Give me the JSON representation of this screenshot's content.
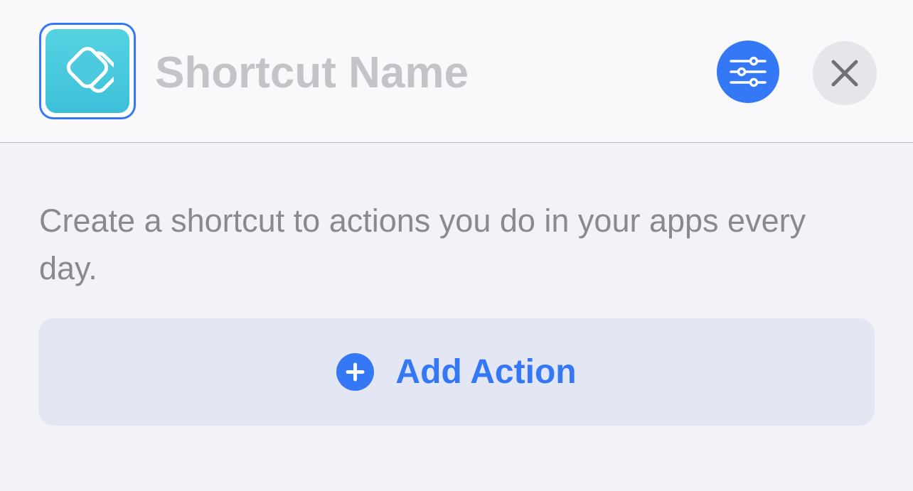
{
  "header": {
    "title_placeholder": "Shortcut Name",
    "app_icon": "shortcuts-layers-icon",
    "settings_icon": "sliders-icon",
    "close_icon": "close-icon"
  },
  "main": {
    "description": "Create a shortcut to actions you do in your apps every day.",
    "add_action_label": "Add Action",
    "add_action_icon": "plus-circle-icon"
  },
  "colors": {
    "accent": "#3478f6",
    "icon_gradient_top": "#55d3e2",
    "icon_gradient_bottom": "#3cc0d9",
    "background": "#f2f2f7",
    "header_background": "#f9f9fb",
    "add_action_background": "#e3e6f3"
  }
}
